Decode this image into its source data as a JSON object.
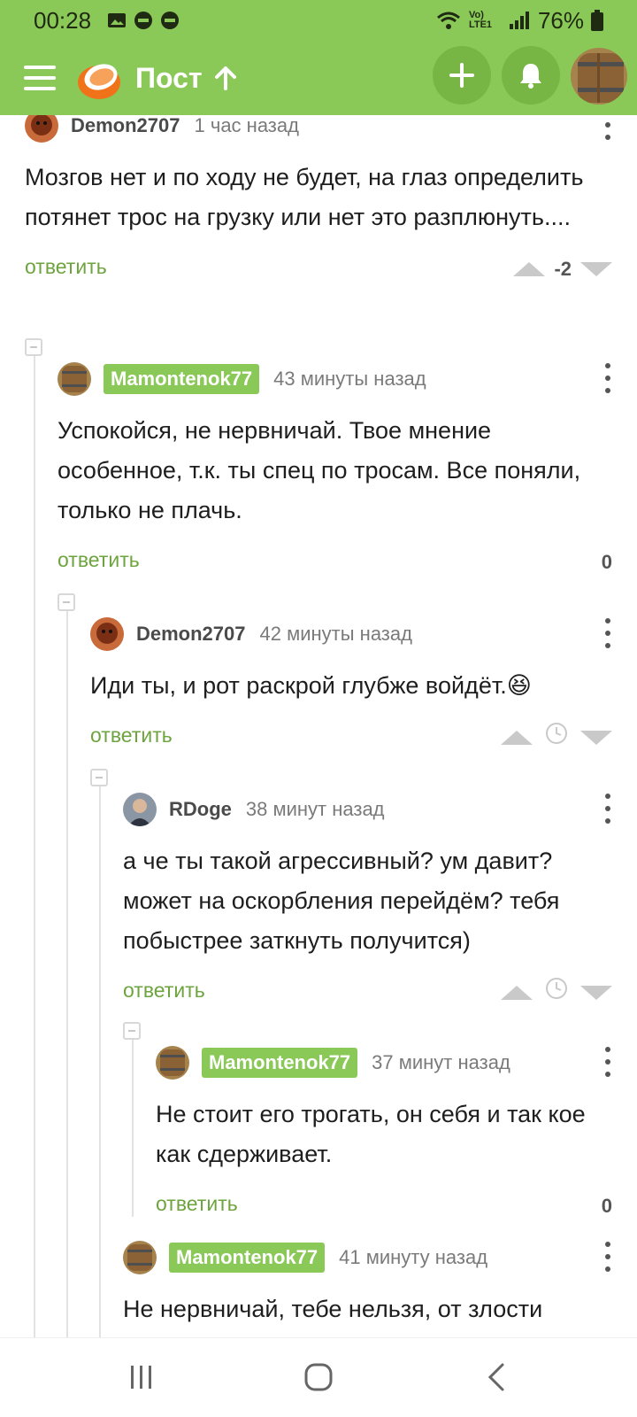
{
  "status_bar": {
    "time": "00:28",
    "battery": "76%",
    "network": "Vo) LTE1"
  },
  "app_bar": {
    "title": "Пост"
  },
  "colors": {
    "brand_green": "#8ac858",
    "reply_green": "#6ea43f"
  },
  "comments": [
    {
      "author": "Demon2707",
      "time": "1 час назад",
      "text": "Мозгов нет и по ходу не будет, на глаз определить потянет трос на грузку или нет это разплюнуть....",
      "reply_label": "ответить",
      "score": "-2"
    },
    {
      "author": "Mamontenok77",
      "time": "43 минуты назад",
      "text": "Успокойся, не нервничай. Твое мнение особенное, т.к. ты спец по тросам. Все поняли, только не плачь.",
      "reply_label": "ответить",
      "score": "0"
    },
    {
      "author": "Demon2707",
      "time": "42 минуты назад",
      "text": "Иди ты, и рот раскрой глубже войдёт.😆",
      "reply_label": "ответить",
      "score": ""
    },
    {
      "author": "RDoge",
      "time": "38 минут назад",
      "text": "а че ты такой агрессивный? ум давит? может на оскорбления перейдём? тебя побыстрее заткнуть получится)",
      "reply_label": "ответить",
      "score": ""
    },
    {
      "author": "Mamontenok77",
      "time": "37 минут назад",
      "text": "Не стоит его трогать, он себя и так кое как сдерживает.",
      "reply_label": "ответить",
      "score": "0"
    },
    {
      "author": "Mamontenok77",
      "time": "41 минуту назад",
      "text": "Не нервничай, тебе нельзя, от злости",
      "reply_label": "",
      "score": ""
    }
  ]
}
